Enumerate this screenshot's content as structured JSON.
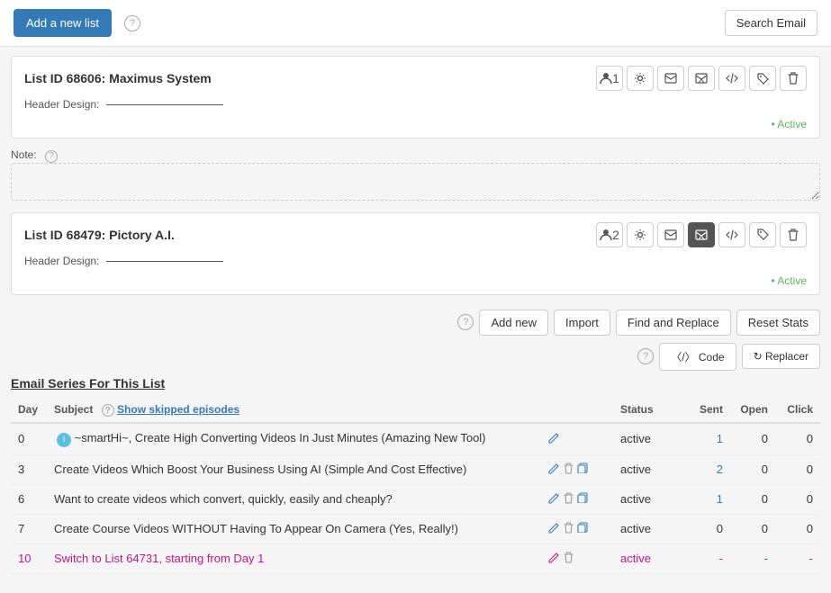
{
  "topBar": {
    "addNewListLabel": "Add a new list",
    "searchEmailLabel": "Search Email",
    "helpTooltip": "?"
  },
  "lists": [
    {
      "id": "list-68606",
      "title": "List ID 68606: Maximus System",
      "headerDesignLabel": "Header Design:",
      "headerDesignUnderline": "",
      "activeLabel": "Active",
      "noteLabel": "Note:",
      "notePlaceholder": "",
      "icons": [
        "person-icon",
        "gear-icon",
        "email-icon",
        "envelope-icon",
        "code-icon",
        "tag-icon",
        "trash-icon"
      ],
      "subscriberCount": "1"
    },
    {
      "id": "list-68479",
      "title": "List ID 68479: Pictory A.I.",
      "headerDesignLabel": "Header Design:",
      "headerDesignUnderline": "",
      "activeLabel": "Active",
      "icons": [
        "person-icon",
        "gear-icon",
        "email-icon",
        "envelope-icon",
        "code-icon",
        "tag-icon",
        "trash-icon"
      ],
      "subscriberCount": "2",
      "showSeries": true,
      "seriesToolbar": {
        "addNewLabel": "Add new",
        "importLabel": "Import",
        "findAndReplaceLabel": "Find and Replace",
        "resetStatsLabel": "Reset Stats",
        "codeLabel": "Code",
        "replacerLabel": "Replacer",
        "helpIcon": "?"
      },
      "seriesTitle": "Email Series For This List",
      "tableHeaders": [
        "Day",
        "Subject",
        "",
        "Status",
        "Sent",
        "Open",
        "Click"
      ],
      "showSkippedEpisodes": "Show skipped episodes",
      "rows": [
        {
          "day": "0",
          "hasInfo": true,
          "subject": "~smartHi~, Create High Converting Videos In Just Minutes (Amazing New Tool)",
          "actionsEdit": true,
          "actionsDelete": false,
          "actionsCopy": false,
          "status": "active",
          "sent": "1",
          "sentIsLink": true,
          "open": "0",
          "click": "0",
          "isMagenta": false
        },
        {
          "day": "3",
          "hasInfo": false,
          "subject": "Create Videos Which Boost Your Business Using AI (Simple And Cost Effective)",
          "actionsEdit": true,
          "actionsDelete": true,
          "actionsCopy": true,
          "status": "active",
          "sent": "2",
          "sentIsLink": true,
          "open": "0",
          "click": "0",
          "isMagenta": false
        },
        {
          "day": "6",
          "hasInfo": false,
          "subject": "Want to create videos which convert, quickly, easily and cheaply?",
          "actionsEdit": true,
          "actionsDelete": true,
          "actionsCopy": true,
          "status": "active",
          "sent": "1",
          "sentIsLink": true,
          "open": "0",
          "click": "0",
          "isMagenta": false
        },
        {
          "day": "7",
          "hasInfo": false,
          "subject": "Create Course Videos WITHOUT Having To Appear On Camera (Yes, Really!)",
          "actionsEdit": true,
          "actionsDelete": true,
          "actionsCopy": true,
          "status": "active",
          "sent": "0",
          "sentIsLink": false,
          "open": "0",
          "click": "0",
          "isMagenta": false
        },
        {
          "day": "10",
          "hasInfo": false,
          "subject": "Switch to List 64731, starting from Day 1",
          "actionsEdit": true,
          "actionsDelete": true,
          "actionsCopy": false,
          "status": "active",
          "sent": "-",
          "sentIsLink": false,
          "open": "-",
          "click": "-",
          "isMagenta": true
        }
      ]
    }
  ]
}
